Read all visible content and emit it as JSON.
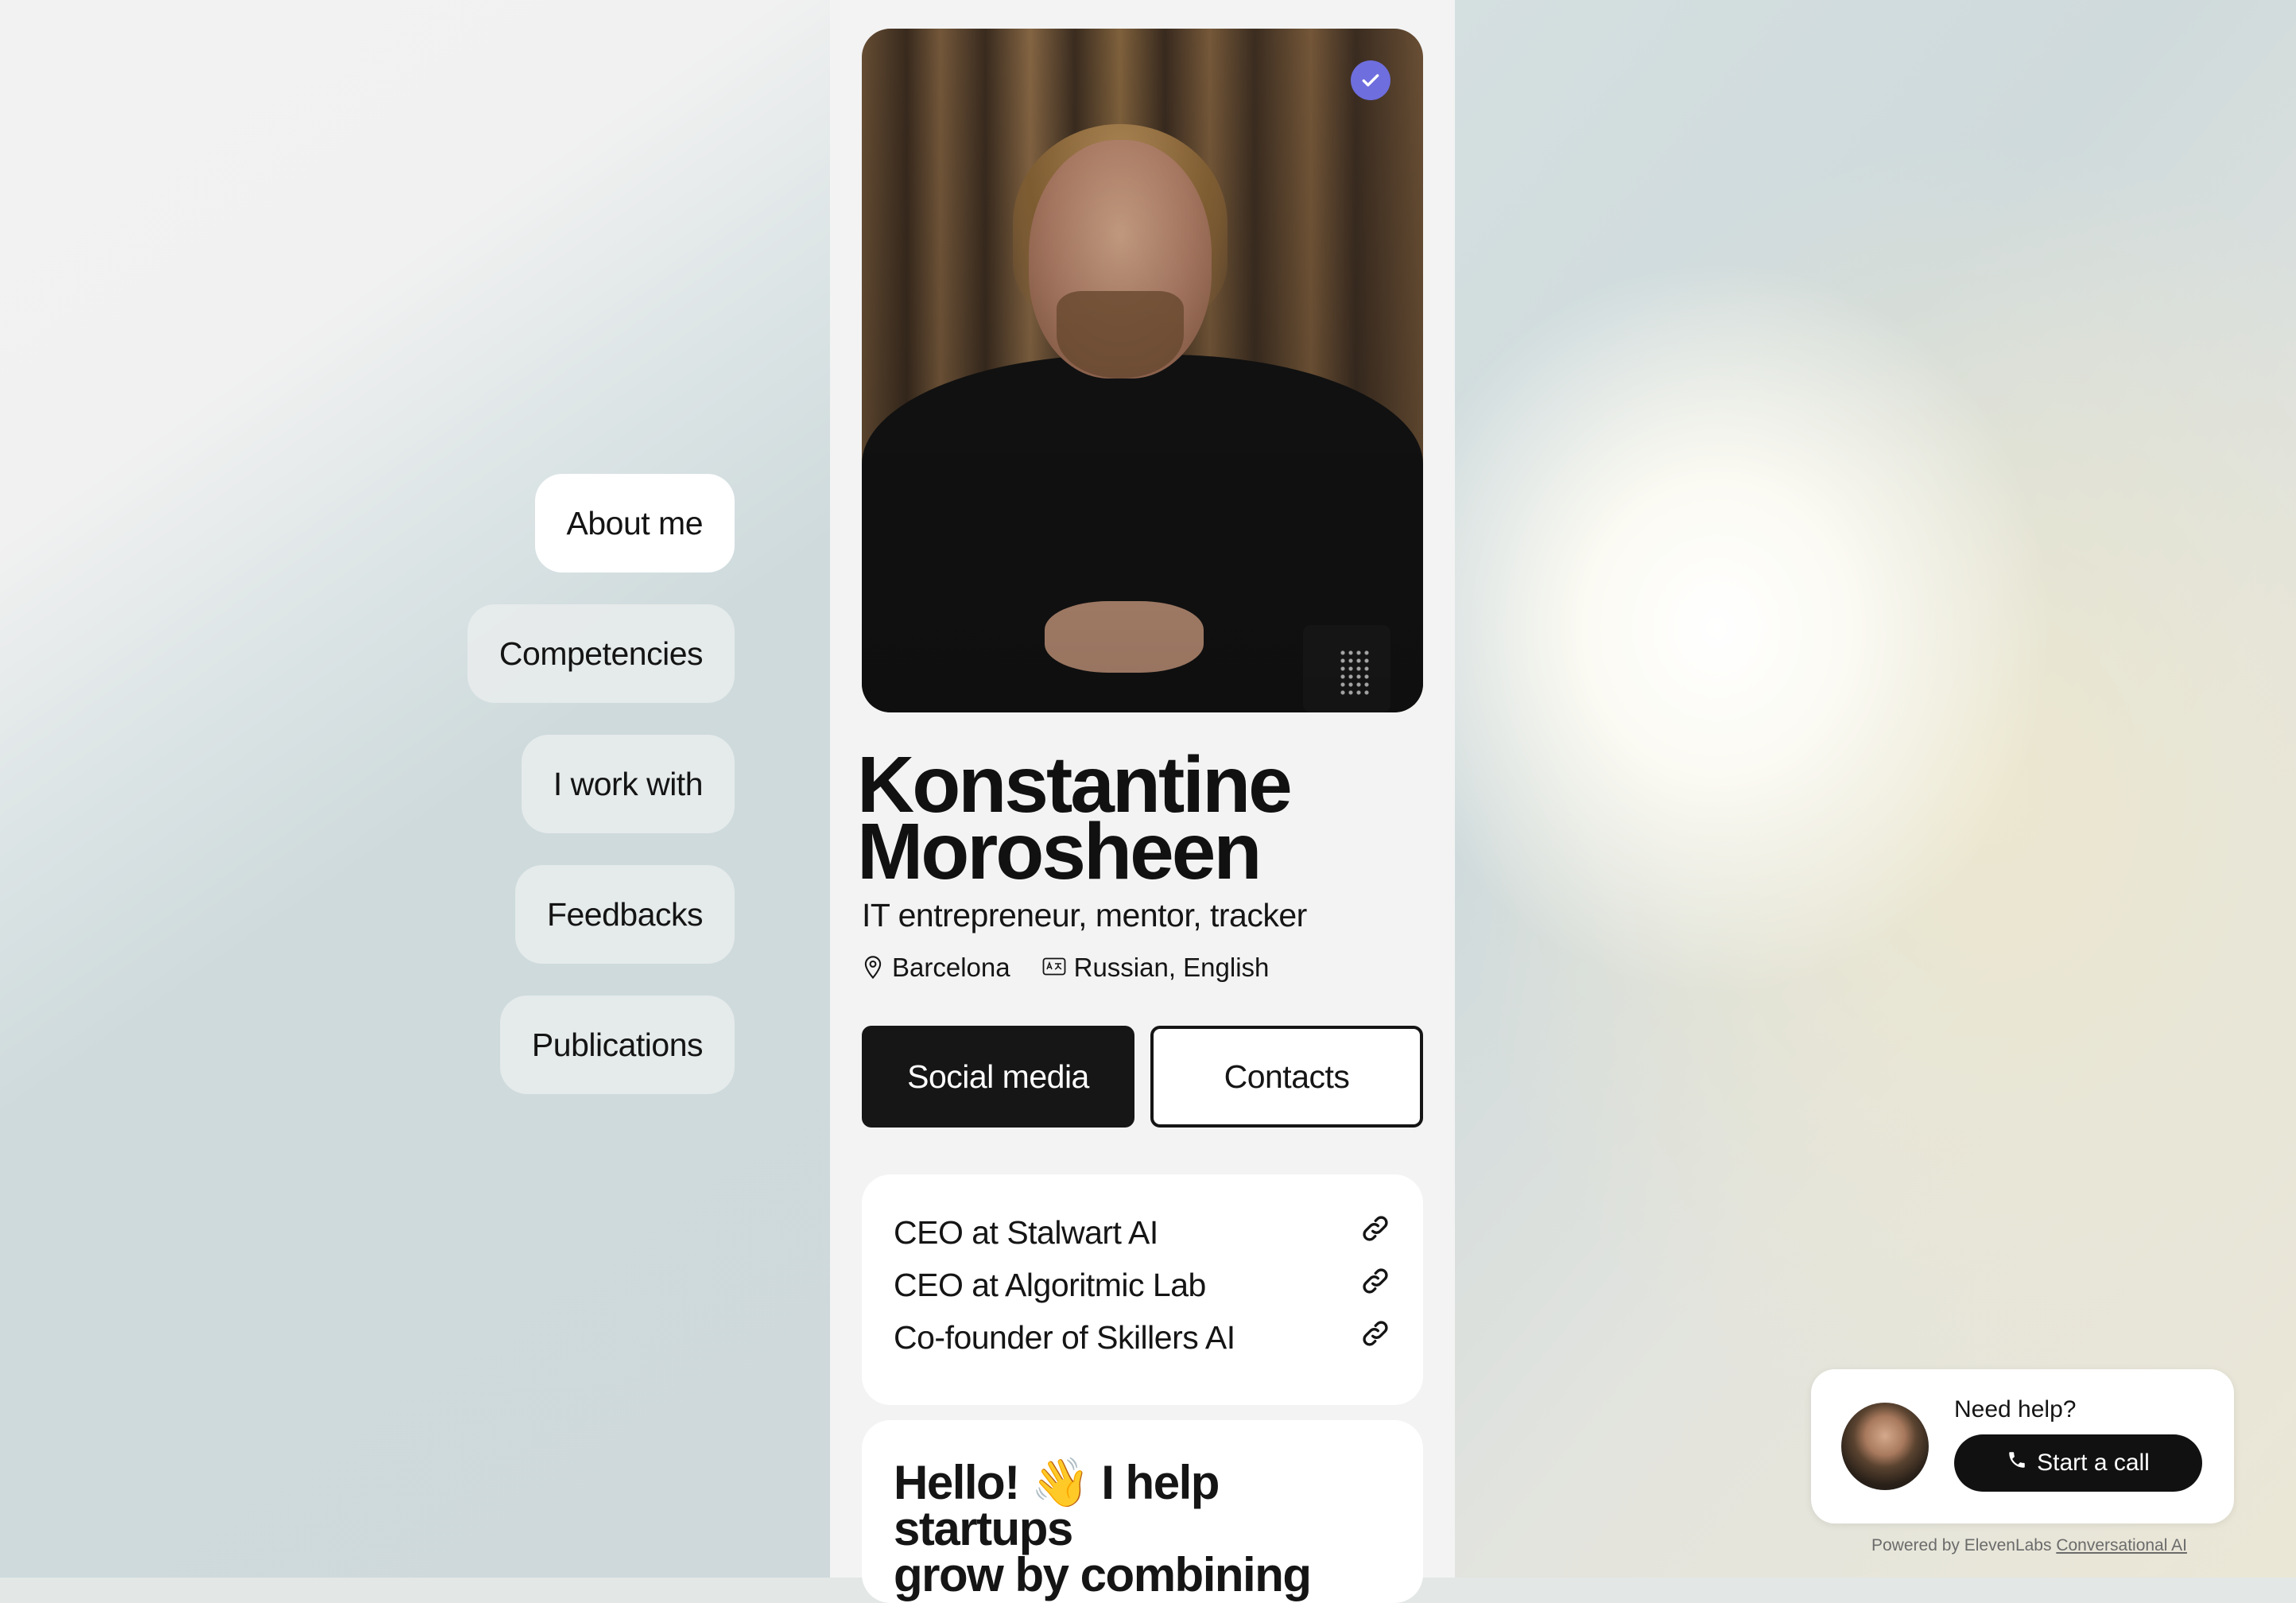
{
  "nav": {
    "items": [
      {
        "label": "About me",
        "active": true
      },
      {
        "label": "Competencies",
        "active": false
      },
      {
        "label": "I work with",
        "active": false
      },
      {
        "label": "Feedbacks",
        "active": false
      },
      {
        "label": "Publications",
        "active": false
      }
    ]
  },
  "profile": {
    "name_line1": "Konstantine",
    "name_line2": "Morosheen",
    "tagline": "IT entrepreneur, mentor, tracker",
    "location": "Barcelona",
    "languages": "Russian, English",
    "verified_color": "#6e6ede"
  },
  "tabs": {
    "social": "Social media",
    "contacts": "Contacts"
  },
  "roles": [
    {
      "label": "CEO at Stalwart AI"
    },
    {
      "label": "CEO at Algoritmic Lab"
    },
    {
      "label": "Co-founder of Skillers AI"
    }
  ],
  "intro": {
    "line1": "Hello! 👋 I help startups",
    "line2": "grow by combining"
  },
  "widget": {
    "help": "Need help?",
    "call": "Start a call",
    "powered_prefix": "Powered by ElevenLabs",
    "powered_link": "Conversational AI"
  }
}
